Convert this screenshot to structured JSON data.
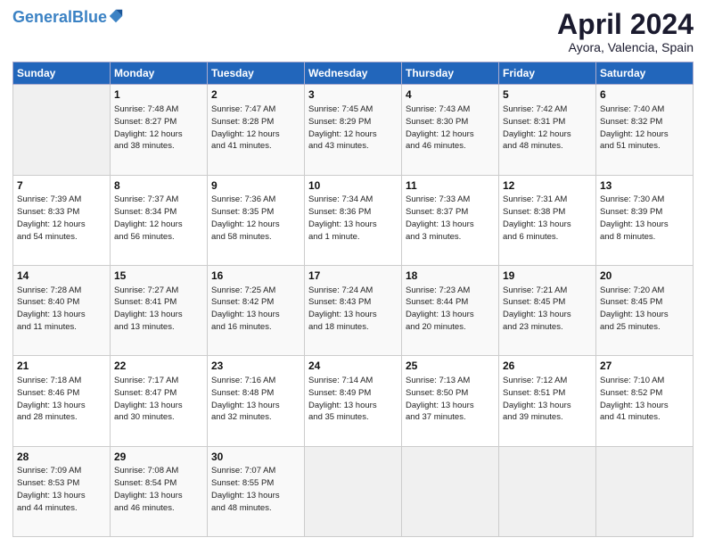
{
  "header": {
    "logo_text_general": "General",
    "logo_text_blue": "Blue",
    "title": "April 2024",
    "subtitle": "Ayora, Valencia, Spain"
  },
  "weekdays": [
    "Sunday",
    "Monday",
    "Tuesday",
    "Wednesday",
    "Thursday",
    "Friday",
    "Saturday"
  ],
  "weeks": [
    [
      {
        "num": "",
        "info": ""
      },
      {
        "num": "1",
        "info": "Sunrise: 7:48 AM\nSunset: 8:27 PM\nDaylight: 12 hours\nand 38 minutes."
      },
      {
        "num": "2",
        "info": "Sunrise: 7:47 AM\nSunset: 8:28 PM\nDaylight: 12 hours\nand 41 minutes."
      },
      {
        "num": "3",
        "info": "Sunrise: 7:45 AM\nSunset: 8:29 PM\nDaylight: 12 hours\nand 43 minutes."
      },
      {
        "num": "4",
        "info": "Sunrise: 7:43 AM\nSunset: 8:30 PM\nDaylight: 12 hours\nand 46 minutes."
      },
      {
        "num": "5",
        "info": "Sunrise: 7:42 AM\nSunset: 8:31 PM\nDaylight: 12 hours\nand 48 minutes."
      },
      {
        "num": "6",
        "info": "Sunrise: 7:40 AM\nSunset: 8:32 PM\nDaylight: 12 hours\nand 51 minutes."
      }
    ],
    [
      {
        "num": "7",
        "info": "Sunrise: 7:39 AM\nSunset: 8:33 PM\nDaylight: 12 hours\nand 54 minutes."
      },
      {
        "num": "8",
        "info": "Sunrise: 7:37 AM\nSunset: 8:34 PM\nDaylight: 12 hours\nand 56 minutes."
      },
      {
        "num": "9",
        "info": "Sunrise: 7:36 AM\nSunset: 8:35 PM\nDaylight: 12 hours\nand 58 minutes."
      },
      {
        "num": "10",
        "info": "Sunrise: 7:34 AM\nSunset: 8:36 PM\nDaylight: 13 hours\nand 1 minute."
      },
      {
        "num": "11",
        "info": "Sunrise: 7:33 AM\nSunset: 8:37 PM\nDaylight: 13 hours\nand 3 minutes."
      },
      {
        "num": "12",
        "info": "Sunrise: 7:31 AM\nSunset: 8:38 PM\nDaylight: 13 hours\nand 6 minutes."
      },
      {
        "num": "13",
        "info": "Sunrise: 7:30 AM\nSunset: 8:39 PM\nDaylight: 13 hours\nand 8 minutes."
      }
    ],
    [
      {
        "num": "14",
        "info": "Sunrise: 7:28 AM\nSunset: 8:40 PM\nDaylight: 13 hours\nand 11 minutes."
      },
      {
        "num": "15",
        "info": "Sunrise: 7:27 AM\nSunset: 8:41 PM\nDaylight: 13 hours\nand 13 minutes."
      },
      {
        "num": "16",
        "info": "Sunrise: 7:25 AM\nSunset: 8:42 PM\nDaylight: 13 hours\nand 16 minutes."
      },
      {
        "num": "17",
        "info": "Sunrise: 7:24 AM\nSunset: 8:43 PM\nDaylight: 13 hours\nand 18 minutes."
      },
      {
        "num": "18",
        "info": "Sunrise: 7:23 AM\nSunset: 8:44 PM\nDaylight: 13 hours\nand 20 minutes."
      },
      {
        "num": "19",
        "info": "Sunrise: 7:21 AM\nSunset: 8:45 PM\nDaylight: 13 hours\nand 23 minutes."
      },
      {
        "num": "20",
        "info": "Sunrise: 7:20 AM\nSunset: 8:45 PM\nDaylight: 13 hours\nand 25 minutes."
      }
    ],
    [
      {
        "num": "21",
        "info": "Sunrise: 7:18 AM\nSunset: 8:46 PM\nDaylight: 13 hours\nand 28 minutes."
      },
      {
        "num": "22",
        "info": "Sunrise: 7:17 AM\nSunset: 8:47 PM\nDaylight: 13 hours\nand 30 minutes."
      },
      {
        "num": "23",
        "info": "Sunrise: 7:16 AM\nSunset: 8:48 PM\nDaylight: 13 hours\nand 32 minutes."
      },
      {
        "num": "24",
        "info": "Sunrise: 7:14 AM\nSunset: 8:49 PM\nDaylight: 13 hours\nand 35 minutes."
      },
      {
        "num": "25",
        "info": "Sunrise: 7:13 AM\nSunset: 8:50 PM\nDaylight: 13 hours\nand 37 minutes."
      },
      {
        "num": "26",
        "info": "Sunrise: 7:12 AM\nSunset: 8:51 PM\nDaylight: 13 hours\nand 39 minutes."
      },
      {
        "num": "27",
        "info": "Sunrise: 7:10 AM\nSunset: 8:52 PM\nDaylight: 13 hours\nand 41 minutes."
      }
    ],
    [
      {
        "num": "28",
        "info": "Sunrise: 7:09 AM\nSunset: 8:53 PM\nDaylight: 13 hours\nand 44 minutes."
      },
      {
        "num": "29",
        "info": "Sunrise: 7:08 AM\nSunset: 8:54 PM\nDaylight: 13 hours\nand 46 minutes."
      },
      {
        "num": "30",
        "info": "Sunrise: 7:07 AM\nSunset: 8:55 PM\nDaylight: 13 hours\nand 48 minutes."
      },
      {
        "num": "",
        "info": ""
      },
      {
        "num": "",
        "info": ""
      },
      {
        "num": "",
        "info": ""
      },
      {
        "num": "",
        "info": ""
      }
    ]
  ]
}
